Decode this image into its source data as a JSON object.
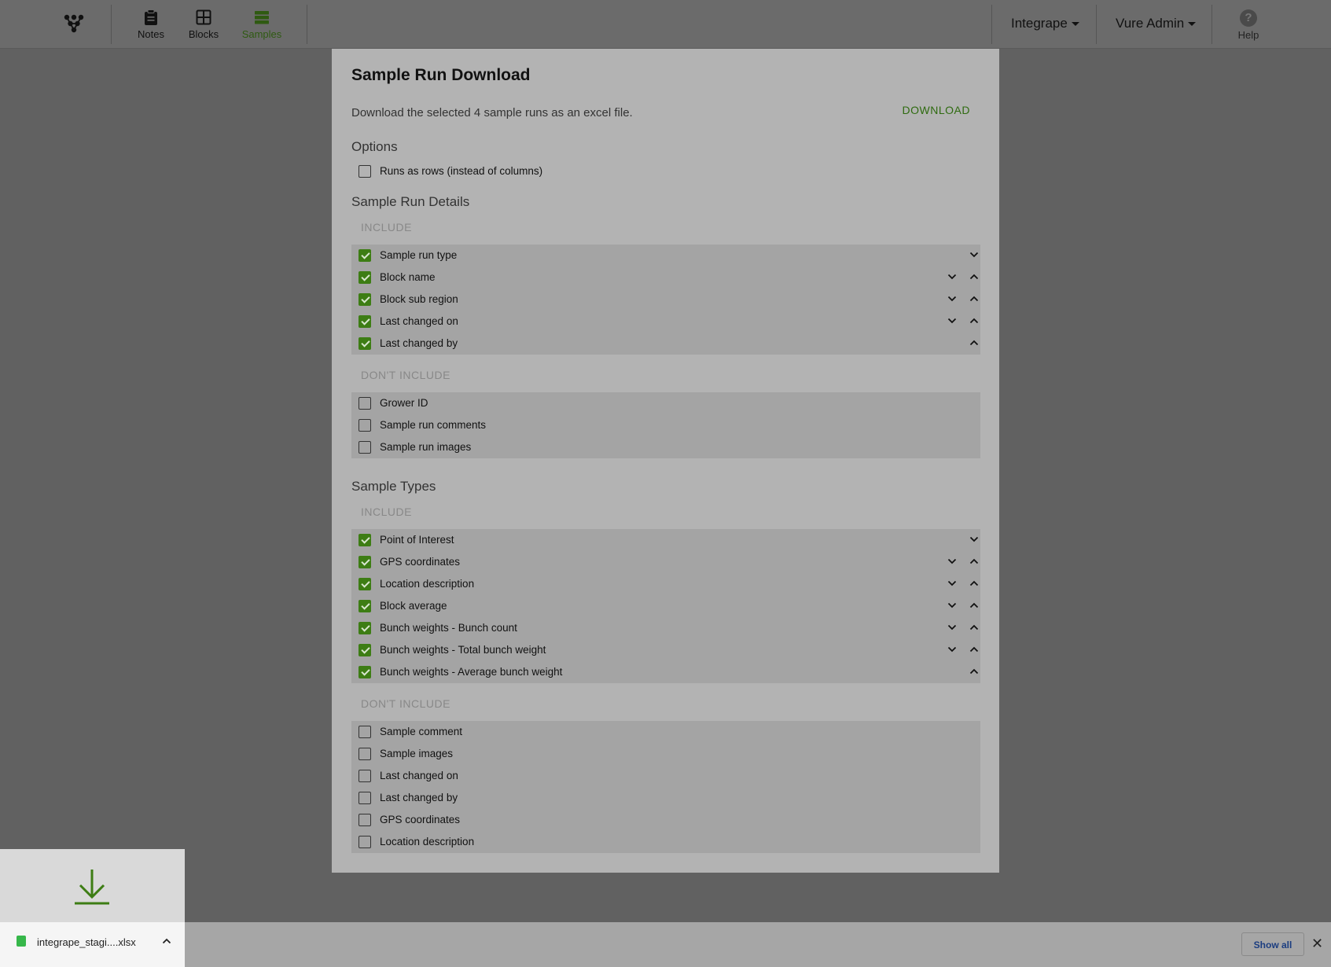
{
  "nav": {
    "items": [
      {
        "label": "Notes",
        "icon": "clipboard-icon"
      },
      {
        "label": "Blocks",
        "icon": "grid-icon"
      },
      {
        "label": "Samples",
        "icon": "list-icon",
        "active": true
      }
    ],
    "org_label": "Integrape",
    "user_label": "Vure Admin",
    "help_label": "Help"
  },
  "modal": {
    "title": "Sample Run Download",
    "description": "Download the selected 4 sample runs as an excel file.",
    "download_label": "DOWNLOAD",
    "options_title": "Options",
    "options": [
      {
        "label": "Runs as rows (instead of columns)",
        "checked": false
      }
    ],
    "details": {
      "title": "Sample Run Details",
      "include_label": "INCLUDE",
      "exclude_label": "DON'T INCLUDE",
      "include": [
        {
          "label": "Sample run type",
          "checked": true
        },
        {
          "label": "Block name",
          "checked": true
        },
        {
          "label": "Block sub region",
          "checked": true
        },
        {
          "label": "Last changed on",
          "checked": true
        },
        {
          "label": "Last changed by",
          "checked": true
        }
      ],
      "exclude": [
        {
          "label": "Grower ID",
          "checked": false
        },
        {
          "label": "Sample run comments",
          "checked": false
        },
        {
          "label": "Sample run images",
          "checked": false
        }
      ]
    },
    "types": {
      "title": "Sample Types",
      "include_label": "INCLUDE",
      "exclude_label": "DON'T INCLUDE",
      "include": [
        {
          "label": "Point of Interest",
          "checked": true
        },
        {
          "label": "GPS coordinates",
          "checked": true
        },
        {
          "label": "Location description",
          "checked": true
        },
        {
          "label": "Block average",
          "checked": true
        },
        {
          "label": "Bunch weights - Bunch count",
          "checked": true
        },
        {
          "label": "Bunch weights - Total bunch weight",
          "checked": true
        },
        {
          "label": "Bunch weights - Average bunch weight",
          "checked": true
        }
      ],
      "exclude": [
        {
          "label": "Sample comment",
          "checked": false
        },
        {
          "label": "Sample images",
          "checked": false
        },
        {
          "label": "Last changed on",
          "checked": false
        },
        {
          "label": "Last changed by",
          "checked": false
        },
        {
          "label": "GPS coordinates",
          "checked": false
        },
        {
          "label": "Location description",
          "checked": false
        }
      ]
    }
  },
  "downloads": {
    "file_name": "integrape_stagi....xlsx",
    "show_all_label": "Show all",
    "close_label": "✕"
  },
  "colors": {
    "accent": "#3d7d14",
    "overlay": "#616161"
  }
}
